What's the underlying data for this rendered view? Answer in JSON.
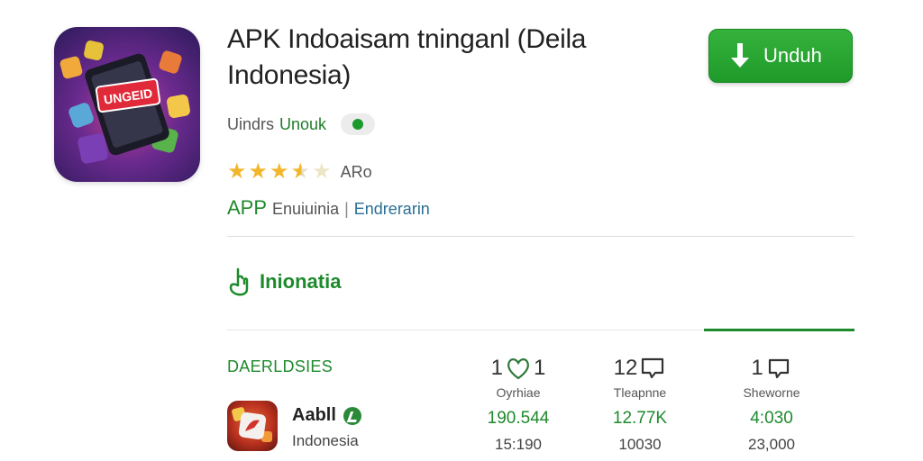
{
  "app": {
    "title": "APK Indoaisam tninganl (Deila Indonesia)",
    "install_label": "Unduh",
    "developer_prefix": "Uindrs",
    "developer_name": "Unouk",
    "rating_stars": 3.5,
    "rating_label": "ARo",
    "category_app": "APP",
    "category_name": "Enuiuinia",
    "category_sep": "|",
    "category_link": "Endrerarin",
    "icon_banner_text": "UNGEID"
  },
  "section": {
    "title": "Inionatia"
  },
  "table": {
    "header": "DAERLDSIES",
    "columns": [
      {
        "count": "1",
        "count_tail": "1",
        "icon": "heart-icon",
        "label": "Oyrhiae",
        "green_value": "190.544",
        "grey_value": "15:190"
      },
      {
        "count": "12",
        "count_tail": "",
        "icon": "comment-icon",
        "label": "Tleapnne",
        "green_value": "12.77K",
        "grey_value": "10030"
      },
      {
        "count": "1",
        "count_tail": "",
        "icon": "chat-icon",
        "label": "Sheworne",
        "green_value": "4:030",
        "grey_value": "23,000"
      }
    ],
    "row": {
      "name": "Aabll",
      "subtitle": "Indonesia"
    }
  },
  "colors": {
    "accent_green": "#1e8a2c",
    "button_green": "#2aa835",
    "star_gold": "#f2b62b",
    "link_blue": "#2a6f95"
  }
}
